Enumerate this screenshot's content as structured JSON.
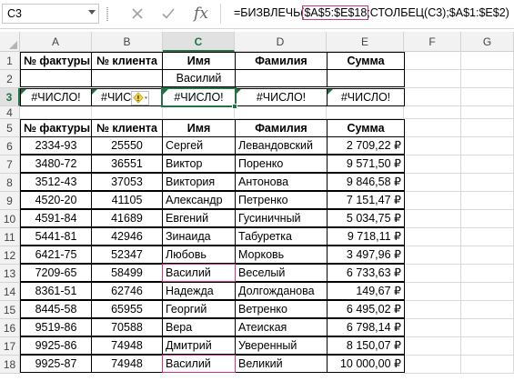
{
  "formula_bar": {
    "name_box": "C3",
    "fx": "fx",
    "formula_prefix": "=БИЗВЛЕЧЬ(",
    "formula_ref": "$A$5:$E$18",
    "formula_suffix": ";СТОЛБЕЦ(C3);$A$1:$E$2)"
  },
  "columns": [
    "A",
    "B",
    "C",
    "D",
    "E",
    "F",
    "G"
  ],
  "rows": [
    "1",
    "2",
    "3",
    "4",
    "5",
    "6",
    "7",
    "8",
    "9",
    "10",
    "11",
    "12",
    "13",
    "14",
    "15",
    "16",
    "17",
    "18"
  ],
  "criteria": {
    "headers": [
      "№ фактуры",
      "№ клиента",
      "Имя",
      "Фамилия",
      "Сумма"
    ],
    "value_c2": "Василий"
  },
  "result_row": [
    "#ЧИСЛО!",
    "#ЧИС",
    "#ЧИСЛО!",
    "#ЧИСЛО!",
    "#ЧИСЛО!"
  ],
  "error_badge": "!",
  "table": {
    "headers": [
      "№ фактуры",
      "№ клиента",
      "Имя",
      "Фамилия",
      "Сумма"
    ],
    "rows": [
      [
        "2334-93",
        "25550",
        "Сергей",
        "Левандовский",
        "2 709,22 ₽"
      ],
      [
        "3480-72",
        "36551",
        "Виктор",
        "Поренко",
        "9 571,50 ₽"
      ],
      [
        "3512-43",
        "37053",
        "Виктория",
        "Антонова",
        "9 846,58 ₽"
      ],
      [
        "4520-20",
        "41105",
        "Александр",
        "Петренко",
        "7 151,47 ₽"
      ],
      [
        "4591-84",
        "41689",
        "Евгений",
        "Гусиничный",
        "5 034,75 ₽"
      ],
      [
        "5441-81",
        "42946",
        "Зинаида",
        "Табуретка",
        "9 718,11 ₽"
      ],
      [
        "6421-75",
        "52347",
        "Любовь",
        "Морковь",
        "3 497,96 ₽"
      ],
      [
        "7209-65",
        "58499",
        "Василий",
        "Веселый",
        "6 733,63 ₽"
      ],
      [
        "8361-51",
        "62746",
        "Надежда",
        "Долгожданова",
        "149,67 ₽"
      ],
      [
        "8445-58",
        "65955",
        "Георгий",
        "Ветренко",
        "6 495,02 ₽"
      ],
      [
        "9519-86",
        "70588",
        "Вера",
        "Атеиская",
        "6 798,14 ₽"
      ],
      [
        "9925-86",
        "74948",
        "Дмитрий",
        "Уверенный",
        "8 150,07 ₽"
      ],
      [
        "9925-87",
        "74948",
        "Василий",
        "Великий",
        "10 000,00 ₽"
      ]
    ]
  },
  "colors": {
    "accent": "#217346",
    "ref_highlight": "#cc3380",
    "error_tri": "#1e7145"
  }
}
